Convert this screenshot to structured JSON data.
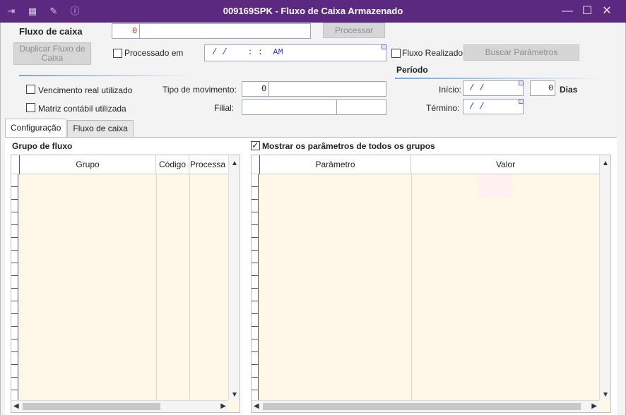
{
  "window": {
    "title": "009169SPK - Fluxo de Caixa Armazenado",
    "toolbar_icons": [
      "arrow-in-icon",
      "database-icon",
      "wrench-icon",
      "info-icon"
    ],
    "controls": [
      "minimize",
      "maximize",
      "close"
    ]
  },
  "form": {
    "fluxo_label": "Fluxo de caixa",
    "fluxo_value": "0",
    "processar_label": "Processar",
    "duplicar_label": "Duplicar Fluxo de Caixa",
    "processado_label": "Processado em",
    "processado_value": "/ /    : :  AM",
    "fluxo_realizado_label": "Fluxo Realizado",
    "buscar_label": "Buscar Parâmetros",
    "vencimento_label": "Vencimento real utilizado",
    "matriz_label": "Matriz contábil utilizada",
    "tipo_mov_label": "Tipo de movimento:",
    "tipo_mov_value": "0",
    "filial_label": "Filial:",
    "periodo_label": "Período",
    "inicio_label": "Início:",
    "inicio_value": "/ /",
    "dias_value": "0",
    "dias_label": "Dias",
    "termino_label": "Término:",
    "termino_value": "/ /"
  },
  "tabs": [
    "Configuração",
    "Fluxo de caixa"
  ],
  "left_grid": {
    "title": "Grupo de fluxo",
    "columns": [
      "Grupo",
      "Código",
      "Processa"
    ]
  },
  "right_grid": {
    "checkbox_label": "Mostrar os parâmetros de todos os grupos",
    "columns": [
      "Parâmetro",
      "Valor"
    ]
  },
  "colors": {
    "titlebar": "#5b2a80",
    "grid_bg": "#fff8e8",
    "red_value": "#d9262a",
    "blue_value": "#2b3fbf"
  }
}
